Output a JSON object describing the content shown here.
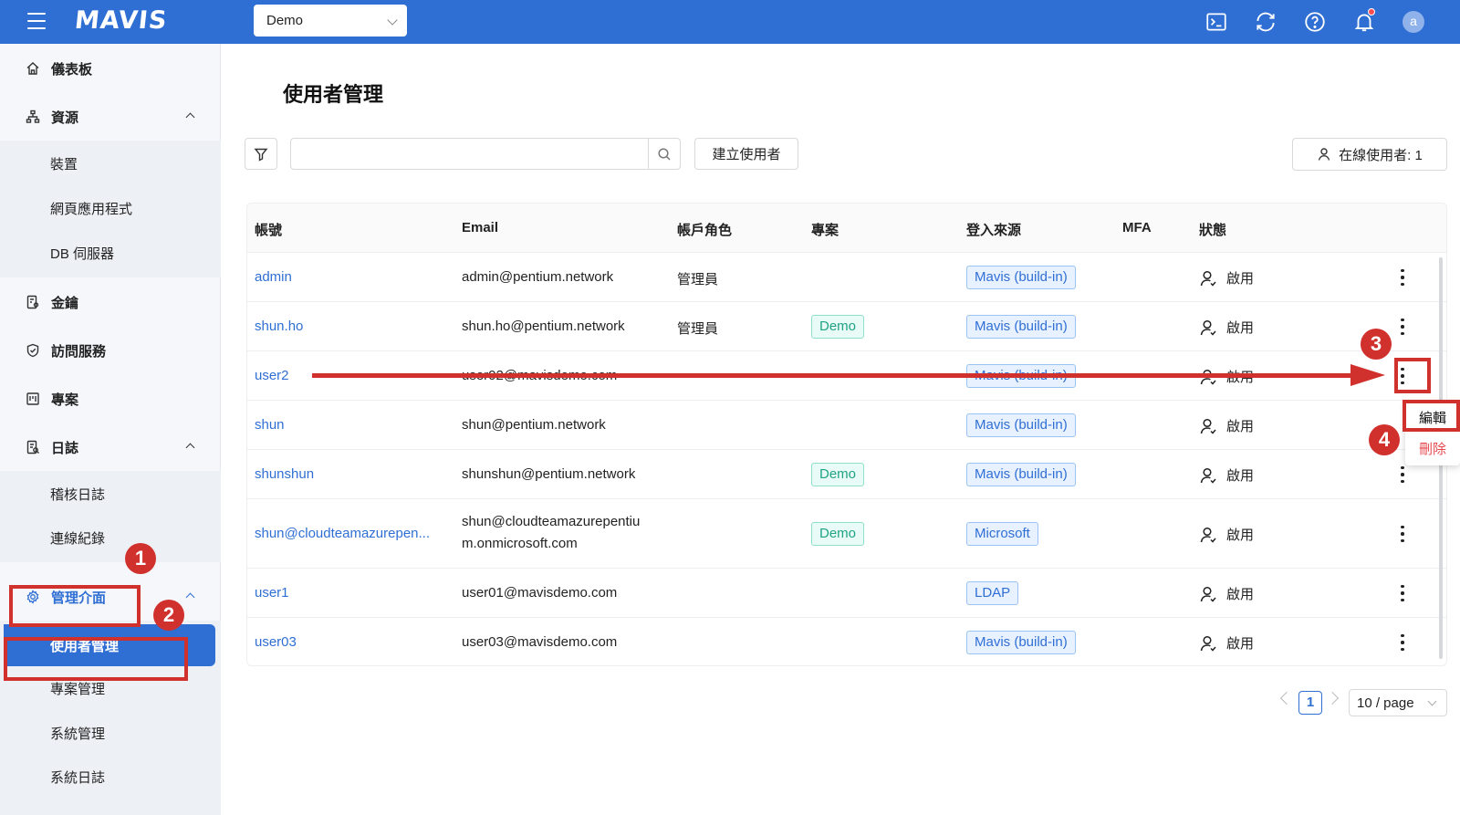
{
  "header": {
    "logo": "MAVIS",
    "project": "Demo",
    "user_initial": "a"
  },
  "sidebar": {
    "items": [
      {
        "label": "儀表板",
        "icon": "home-icon"
      },
      {
        "label": "資源",
        "icon": "sitemap-icon",
        "expanded": true,
        "children": [
          "裝置",
          "網頁應用程式",
          "DB 伺服器"
        ]
      },
      {
        "label": "金鑰",
        "icon": "key-icon"
      },
      {
        "label": "訪問服務",
        "icon": "shield-icon"
      },
      {
        "label": "專案",
        "icon": "project-icon"
      },
      {
        "label": "日誌",
        "icon": "log-icon",
        "expanded": true,
        "children": [
          "稽核日誌",
          "連線紀錄"
        ]
      },
      {
        "label": "管理介面",
        "icon": "gear-icon",
        "expanded": true,
        "children": [
          "使用者管理",
          "專案管理",
          "系統管理",
          "系統日誌"
        ]
      }
    ],
    "active_child": "使用者管理"
  },
  "main": {
    "title": "使用者管理",
    "search_placeholder": "",
    "create_button": "建立使用者",
    "online_users": "在線使用者:  1"
  },
  "table": {
    "columns": [
      "帳號",
      "Email",
      "帳戶角色",
      "專案",
      "登入來源",
      "MFA",
      "狀態"
    ],
    "rows": [
      {
        "account": "admin",
        "email": "admin@pentium.network",
        "role": "管理員",
        "project": "",
        "source": "Mavis (build-in)",
        "mfa": "",
        "status": "啟用"
      },
      {
        "account": "shun.ho",
        "email": "shun.ho@pentium.network",
        "role": "管理員",
        "project": "Demo",
        "source": "Mavis (build-in)",
        "mfa": "",
        "status": "啟用"
      },
      {
        "account": "user2",
        "email": "user02@mavisdemo.com",
        "role": "",
        "project": "",
        "source": "Mavis (build-in)",
        "mfa": "",
        "status": "啟用"
      },
      {
        "account": "shun",
        "email": "shun@pentium.network",
        "role": "",
        "project": "",
        "source": "Mavis (build-in)",
        "mfa": "",
        "status": "啟用"
      },
      {
        "account": "shunshun",
        "email": "shunshun@pentium.network",
        "role": "",
        "project": "Demo",
        "source": "Mavis (build-in)",
        "mfa": "",
        "status": "啟用"
      },
      {
        "account": "shun@cloudteamazurepen...",
        "email_line1": "shun@cloudteamazurepentiu",
        "email_line2": "m.onmicrosoft.com",
        "role": "",
        "project": "Demo",
        "source": "Microsoft",
        "mfa": "",
        "status": "啟用"
      },
      {
        "account": "user1",
        "email": "user01@mavisdemo.com",
        "role": "",
        "project": "",
        "source": "LDAP",
        "mfa": "",
        "status": "啟用"
      },
      {
        "account": "user03",
        "email": "user03@mavisdemo.com",
        "role": "",
        "project": "",
        "source": "Mavis (build-in)",
        "mfa": "",
        "status": "啟用"
      }
    ]
  },
  "row_menu": {
    "edit": "編輯",
    "delete": "刪除"
  },
  "pagination": {
    "current_page": "1",
    "page_size": "10 / page"
  },
  "annotations": {
    "steps": [
      "1",
      "2",
      "3",
      "4"
    ],
    "color": "#d0312d"
  },
  "colors": {
    "primary": "#2f6fd4",
    "danger": "#e5484d",
    "tag_green": "#20a385"
  }
}
